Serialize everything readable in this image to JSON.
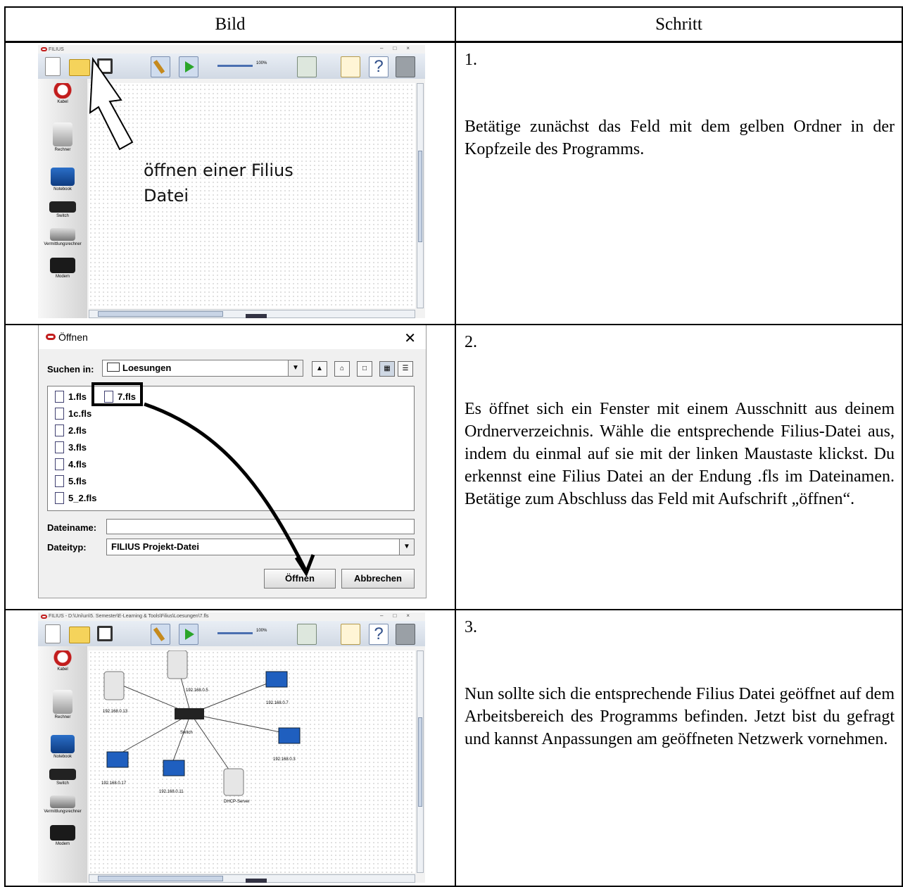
{
  "table": {
    "header_image": "Bild",
    "header_step": "Schritt"
  },
  "rows": [
    {
      "number": "1.",
      "text": "Betätige zunächst das Feld mit dem gelben Ordner in der Kopfzeile des Programms."
    },
    {
      "number": "2.",
      "text": "Es öffnet sich ein Fenster mit einem Ausschnitt aus deinem Ordnerverzeichnis. Wähle die entsprechende Filius-Datei aus, indem du einmal auf sie mit der linken Maustaste klickst. Du erkennst eine Filius Datei an der Endung .fls im Dateinamen. Betätige zum Abschluss das Feld mit Aufschrift „öffnen“."
    },
    {
      "number": "3.",
      "text": "Nun sollte sich die entsprechende Filius Datei geöffnet auf dem Arbeitsbereich des Programms befinden. Jetzt bist du gefragt und kannst Anpassungen am geöffneten Netzwerk vornehmen."
    }
  ],
  "screenshot1": {
    "window_title": "FILIUS",
    "zoom": "100%",
    "annotation_line1": "öffnen einer Filius",
    "annotation_line2": "Datei",
    "palette": [
      "Kabel",
      "Rechner",
      "Notebook",
      "Switch",
      "Vermittlungsrechner",
      "Modem"
    ]
  },
  "screenshot2": {
    "title": "Öffnen",
    "look_in_label": "Suchen in:",
    "look_in_value": "Loesungen",
    "files": [
      "1.fls",
      "1c.fls",
      "2.fls",
      "3.fls",
      "4.fls",
      "5.fls",
      "5_2.fls",
      "7.fls"
    ],
    "filename_label": "Dateiname:",
    "filename_value": "",
    "filetype_label": "Dateityp:",
    "filetype_value": "FILIUS Projekt-Datei",
    "open_button": "Öffnen",
    "cancel_button": "Abbrechen"
  },
  "screenshot3": {
    "window_title": "FILIUS - D:\\Uni\\un\\5. Semester\\E-Learning & Tools\\Filius\\Loesungen\\7.fls",
    "zoom": "100%",
    "palette": [
      "Kabel",
      "Rechner",
      "Notebook",
      "Switch",
      "Vermittlungsrechner",
      "Modem"
    ],
    "nodes": {
      "n1": "192.168.0.5",
      "n2": "192.168.0.13",
      "n3": "192.168.0.7",
      "switch": "Switch",
      "n4": "192.168.0.3",
      "n5": "192.168.0.17",
      "n6": "192.168.0.11",
      "dhcp": "DHCP-Server"
    }
  },
  "colors": {
    "folder": "#f5d35b",
    "cable": "#c21d1d",
    "run": "#2aa52a"
  }
}
